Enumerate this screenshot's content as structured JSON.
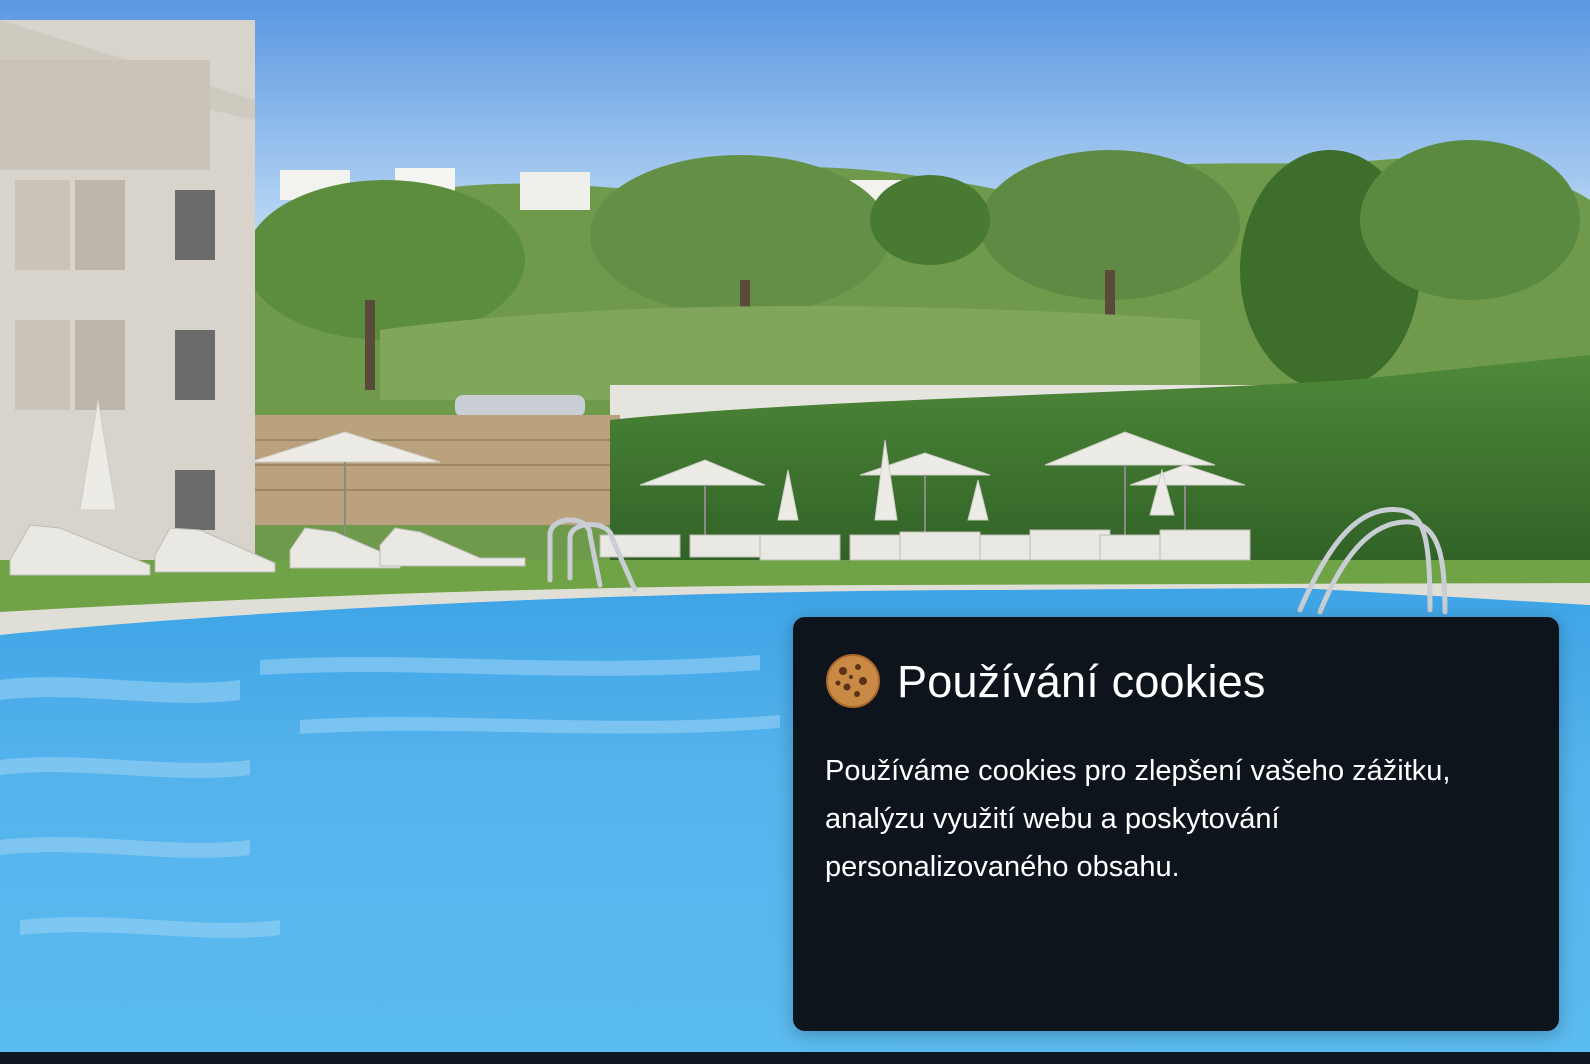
{
  "hero": {
    "image_description_icon": "photo-pool-resort"
  },
  "cookie_banner": {
    "icon": "cookie-icon",
    "title": "Používání cookies",
    "text": "Používáme cookies pro zlepšení vašeho zážitku, analýzu využití webu a poskytování personalizovaného obsahu."
  },
  "colors": {
    "banner_bg": "#0e141c",
    "banner_text": "#ffffff",
    "pool": "#55b4ea",
    "sky": "#7fb3ee"
  }
}
